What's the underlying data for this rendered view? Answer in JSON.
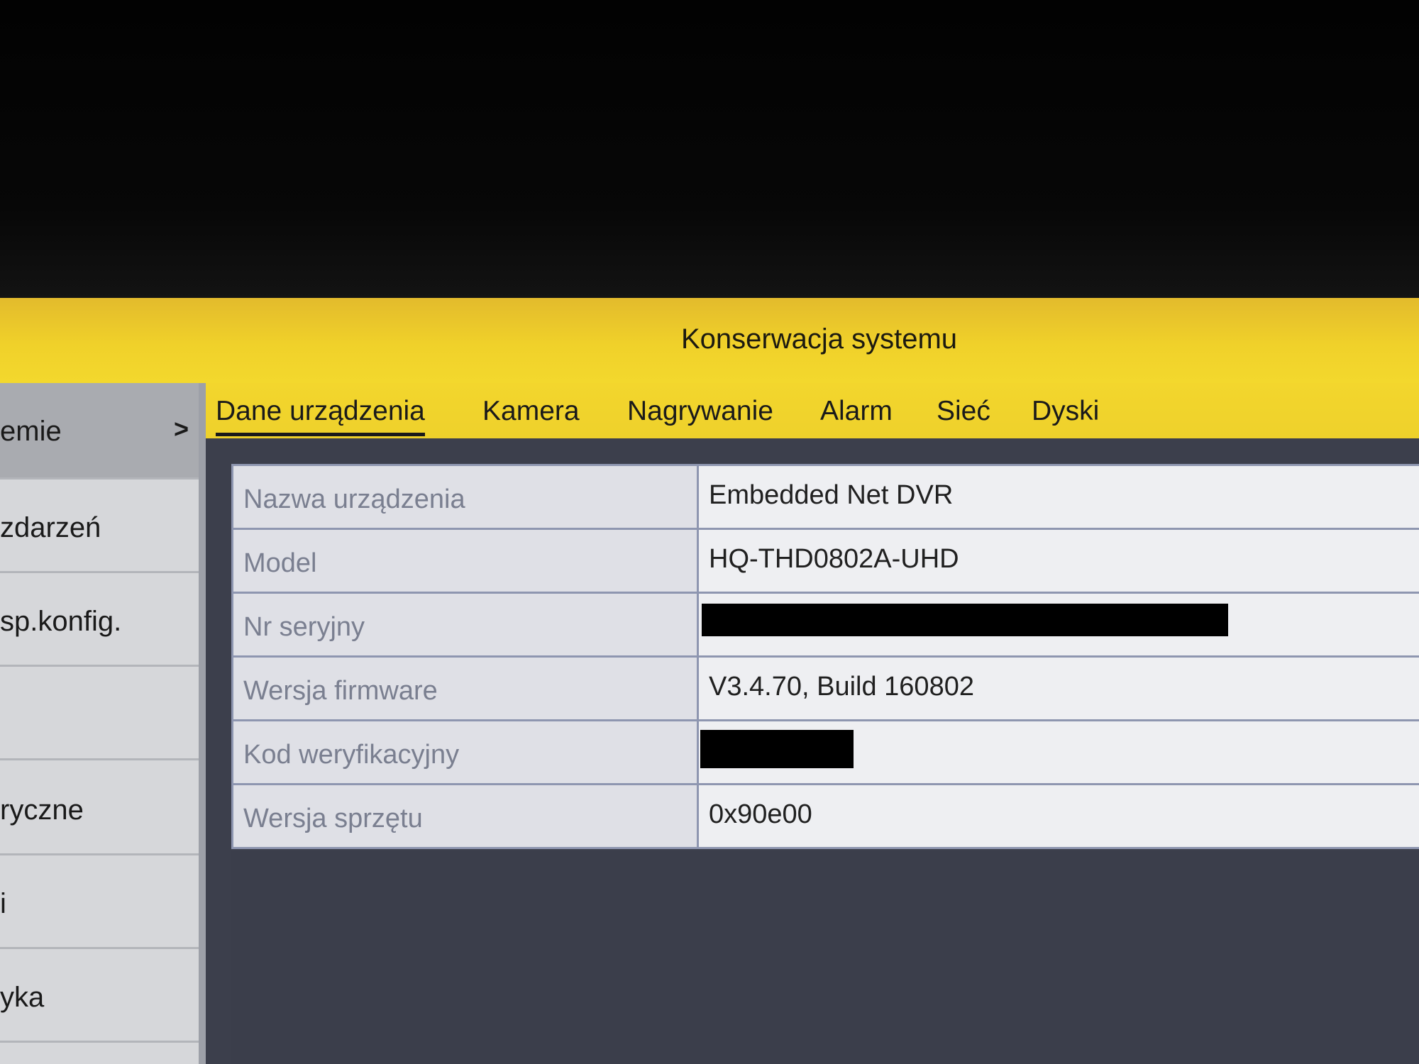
{
  "window": {
    "title": "Konserwacja systemu"
  },
  "sidebar": {
    "items": [
      {
        "label": "emie",
        "active": true
      },
      {
        "label": "zdarzeń"
      },
      {
        "label": "sp.konfig."
      },
      {
        "label": ""
      },
      {
        "label": "ryczne"
      },
      {
        "label": "i"
      },
      {
        "label": "yka"
      }
    ],
    "active_chevron": ">"
  },
  "tabs": [
    {
      "label": "Dane urządzenia",
      "active": true
    },
    {
      "label": "Kamera"
    },
    {
      "label": "Nagrywanie"
    },
    {
      "label": "Alarm"
    },
    {
      "label": "Sieć"
    },
    {
      "label": "Dyski"
    }
  ],
  "device_info": {
    "rows": [
      {
        "label": "Nazwa urządzenia",
        "value": "Embedded Net DVR"
      },
      {
        "label": "Model",
        "value": "HQ-THD0802A-UHD"
      },
      {
        "label": "Nr seryjny",
        "value": ""
      },
      {
        "label": "Wersja firmware",
        "value": "V3.4.70, Build 160802"
      },
      {
        "label": "Kod weryfikacyjny",
        "value": ""
      },
      {
        "label": "Wersja sprzętu",
        "value": "0x90e00"
      }
    ]
  },
  "colors": {
    "title_bar": "#f0d12a",
    "tab_bar": "#f3d62d",
    "table_border": "#8e96b0",
    "label_text": "#7a7f90",
    "value_text": "#202020",
    "sidebar_bg": "#d6d7da",
    "sidebar_active_bg": "#a9abb0",
    "background": "#3c3f4c"
  }
}
